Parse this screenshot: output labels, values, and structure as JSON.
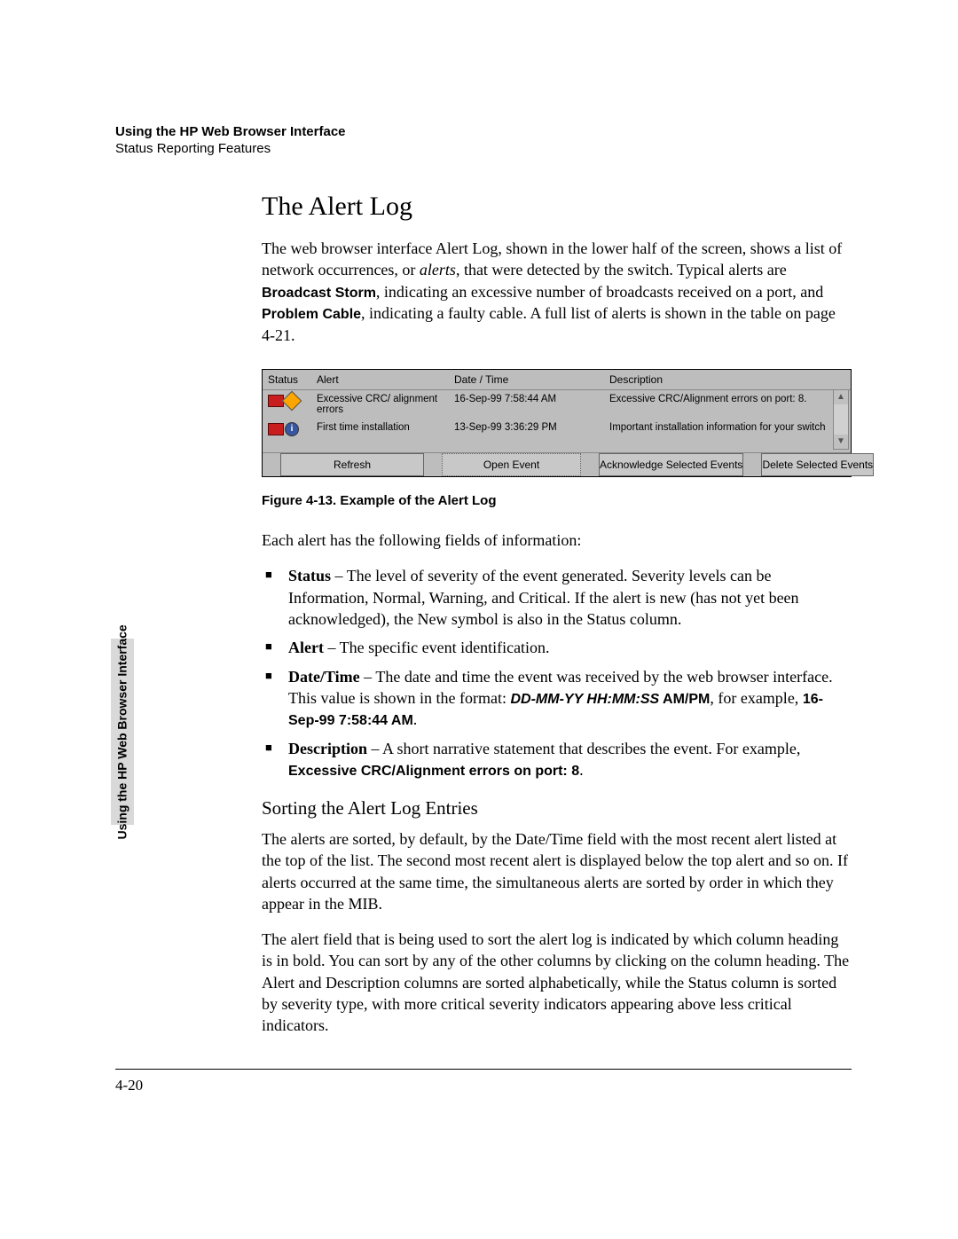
{
  "header": {
    "line1": "Using the HP Web Browser Interface",
    "line2": "Status Reporting Features"
  },
  "title": "The Alert Log",
  "intro": {
    "p1a": "The web browser interface Alert Log, shown in the lower half of the screen, shows a list of network occurrences, or ",
    "p1_em": "alerts",
    "p1b": ", that were detected by the switch. Typical alerts are ",
    "p1_bs": "Broadcast Storm",
    "p1c": ", indicating an excessive number of broadcasts received on a port, and ",
    "p1_pc": "Problem Cable",
    "p1d": ", indicating a faulty cable. A full list of alerts is shown in the table on page 4-21."
  },
  "alert_table": {
    "headers": {
      "status": "Status",
      "alert": "Alert",
      "date": "Date / Time",
      "desc": "Description"
    },
    "rows": [
      {
        "sev": "warn",
        "alert": "Excessive CRC/ alignment errors",
        "date": "16-Sep-99 7:58:44 AM",
        "desc": "Excessive CRC/Alignment errors on port: 8."
      },
      {
        "sev": "info",
        "alert": "First time installation",
        "date": "13-Sep-99 3:36:29 PM",
        "desc": "Important installation information for your switch"
      }
    ],
    "buttons": {
      "refresh": "Refresh",
      "open": "Open Event",
      "ack": "Acknowledge Selected Events",
      "del": "Delete Selected Events"
    }
  },
  "figure_caption": "Figure 4-13.  Example of the Alert Log",
  "lead": "Each alert has the following fields of information:",
  "bullets": {
    "b1_term": "Status",
    "b1_text": " – The level of severity of the event generated. Severity levels can be Information, Normal, Warning, and Critical. If the alert is new (has not yet been acknowledged), the New symbol is also in the Status column.",
    "b2_term": "Alert",
    "b2_text": " – The specific event identification.",
    "b3_term": "Date/Time",
    "b3_text_a": " – The date and time the event was received by the web browser interface. This value is shown in the format: ",
    "b3_fmt_1": "DD-MM-YY HH:MM:SS",
    "b3_fmt_2": " AM/PM",
    "b3_text_b": ", for example, ",
    "b3_example": "16-Sep-99 7:58:44 AM",
    "b3_text_c": ".",
    "b4_term": "Description",
    "b4_text_a": " – A short narrative statement that describes the event. For example, ",
    "b4_example": "Excessive CRC/Alignment errors on port: 8",
    "b4_text_b": "."
  },
  "subsection": "Sorting the Alert Log Entries",
  "sort": {
    "p1": "The alerts are sorted, by default, by the Date/Time field with the most recent alert listed at the top of the list. The second most recent alert is displayed below the top alert and so on. If alerts occurred at the same time, the simultaneous alerts are sorted by order in which they appear in the MIB.",
    "p2": "The alert field that is being used to sort the alert log is indicated by which column heading is in bold. You can sort by any of the other columns by clicking on the column heading. The Alert and Description columns are sorted alphabetically, while the Status column is sorted by severity type, with more critical severity indicators appearing above less critical indicators."
  },
  "side_tab": "Using the HP Web Browser\nInterface",
  "page_number": "4-20"
}
